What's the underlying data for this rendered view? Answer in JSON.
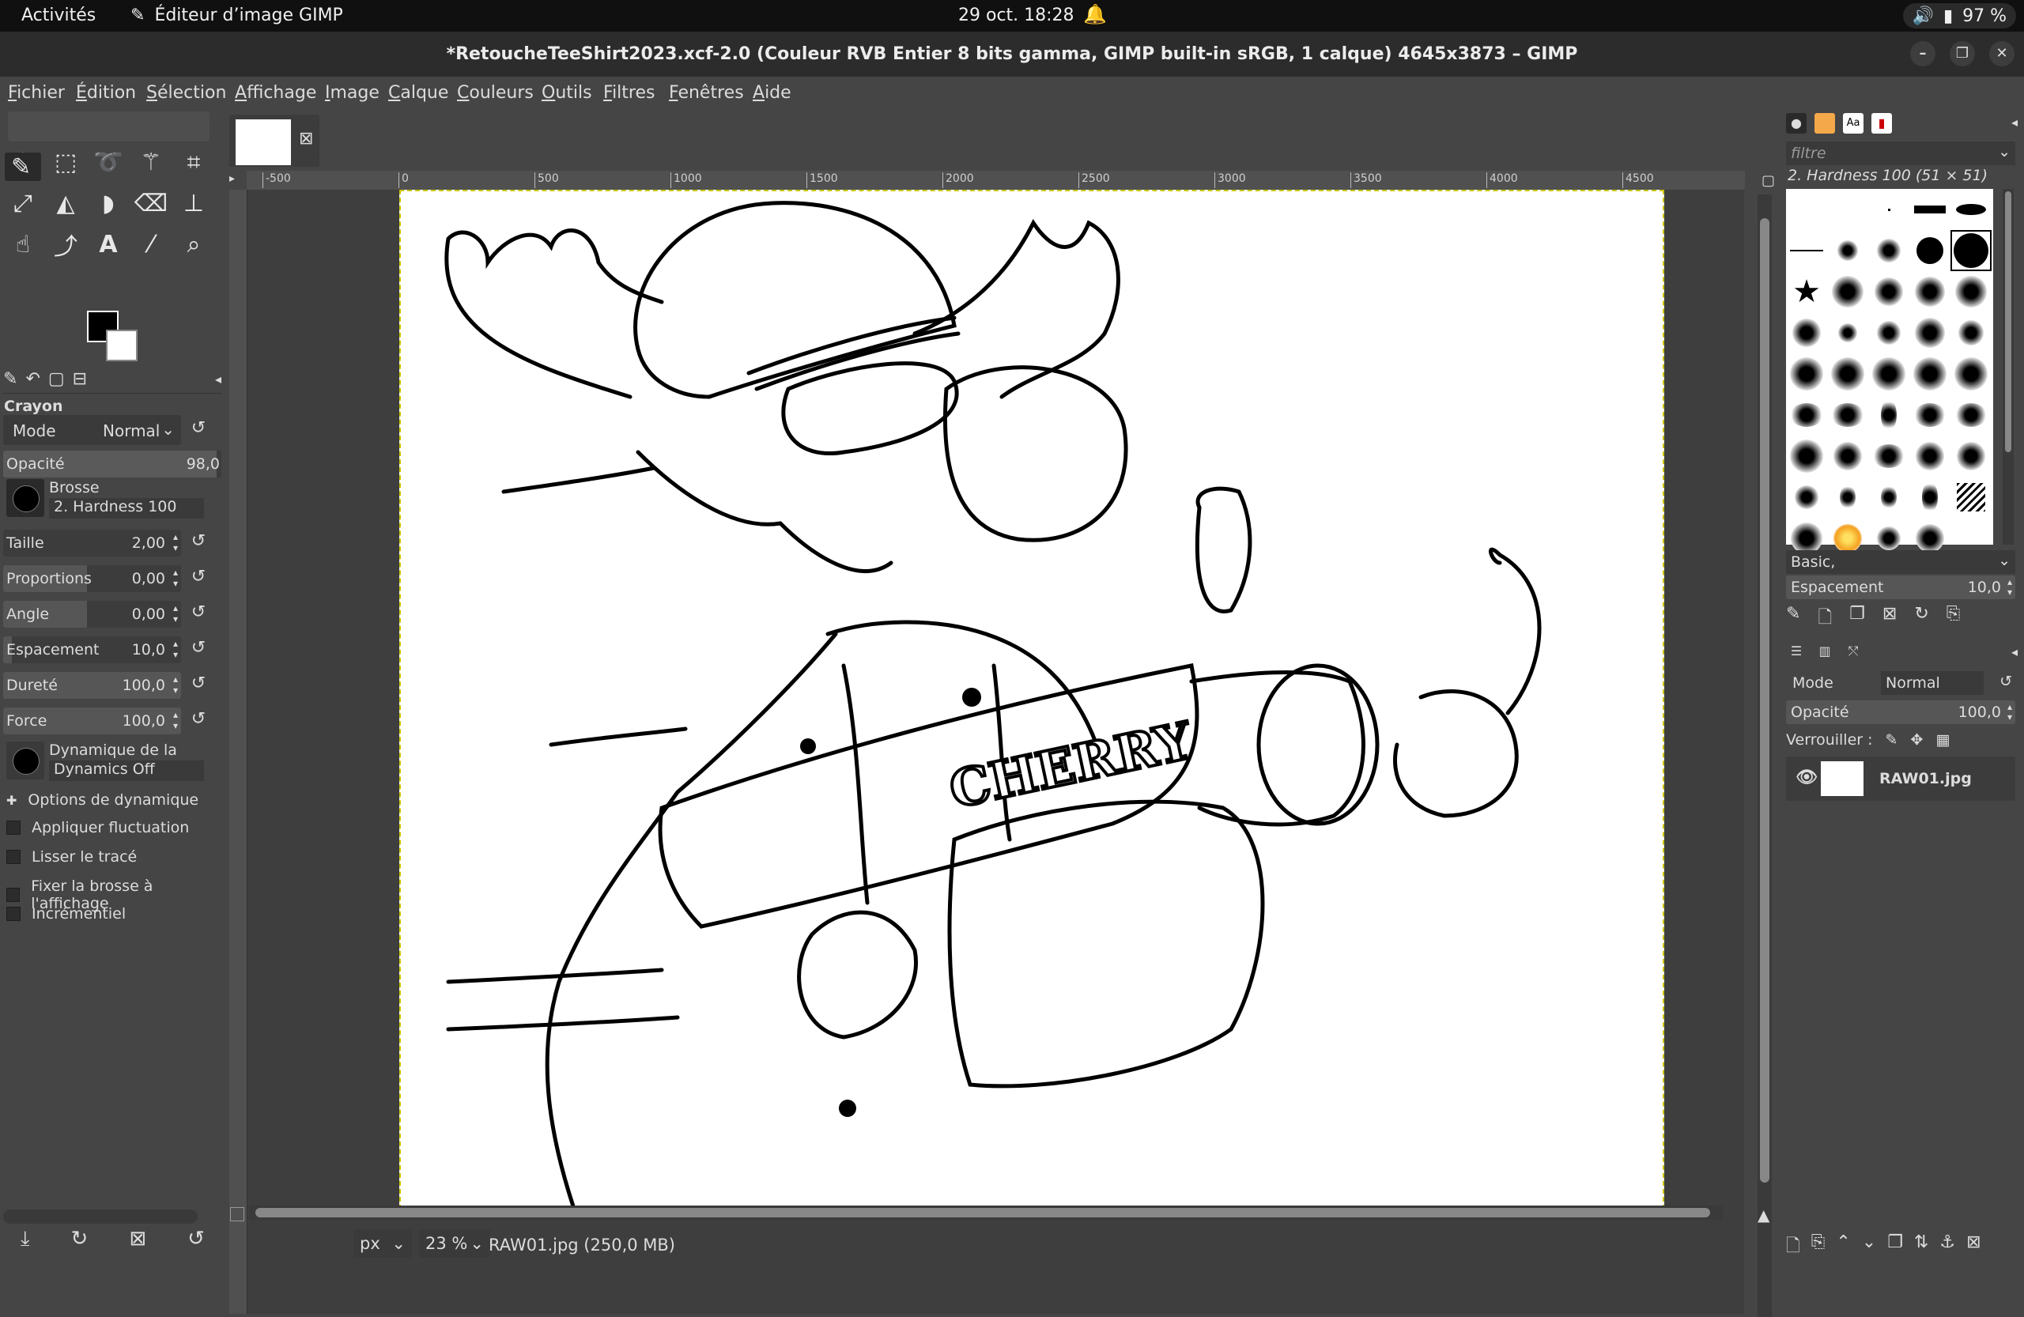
{
  "topbar": {
    "activities": "Activités",
    "app_name": "Éditeur d’image GIMP",
    "clock": "29 oct.  18:28",
    "battery": "97 %"
  },
  "window": {
    "title": "*RetoucheTeeShirt2023.xcf-2.0 (Couleur RVB Entier 8 bits gamma, GIMP built-in sRGB, 1 calque) 4645x3873 – GIMP"
  },
  "menu": [
    "Fichier",
    "Édition",
    "Sélection",
    "Affichage",
    "Image",
    "Calque",
    "Couleurs",
    "Outils",
    "Filtres",
    "Fenêtres",
    "Aide"
  ],
  "tool_options": {
    "title": "Crayon",
    "mode_label": "Mode",
    "mode_value": "Normal",
    "opacity_label": "Opacité",
    "opacity_value": "98,0",
    "brush_label": "Brosse",
    "brush_value": "2. Hardness 100",
    "size_label": "Taille",
    "size_value": "2,00",
    "proportions_label": "Proportions",
    "proportions_value": "0,00",
    "angle_label": "Angle",
    "angle_value": "0,00",
    "spacing_label": "Espacement",
    "spacing_value": "10,0",
    "hardness_label": "Dureté",
    "hardness_value": "100,0",
    "force_label": "Force",
    "force_value": "100,0",
    "dynamics_label": "Dynamique de la brosse",
    "dynamics_value": "Dynamics Off",
    "dyn_options": "Options de dynamique",
    "jitter": "Appliquer fluctuation",
    "smooth": "Lisser le tracé",
    "lock_brush": "Fixer la brosse à l'affichage",
    "incremental": "Incrémentiel"
  },
  "ruler": {
    "ticks": [
      "-500",
      "0",
      "500",
      "1000",
      "1500",
      "2000",
      "2500",
      "3000",
      "3500",
      "4000",
      "4500"
    ]
  },
  "status": {
    "unit": "px",
    "zoom": "23 %",
    "info": "RAW01.jpg (250,0 MB)"
  },
  "brushes": {
    "filter_placeholder": "filtre",
    "selected": "2. Hardness 100 (51 × 51)",
    "preset": "Basic,",
    "spacing_label": "Espacement",
    "spacing_value": "10,0"
  },
  "layers": {
    "mode_label": "Mode",
    "mode_value": "Normal",
    "opacity_label": "Opacité",
    "opacity_value": "100,0",
    "lock_label": "Verrouiller :",
    "items": [
      {
        "name": "RAW01.jpg"
      }
    ]
  },
  "artwork": {
    "text": "CHERRY"
  }
}
